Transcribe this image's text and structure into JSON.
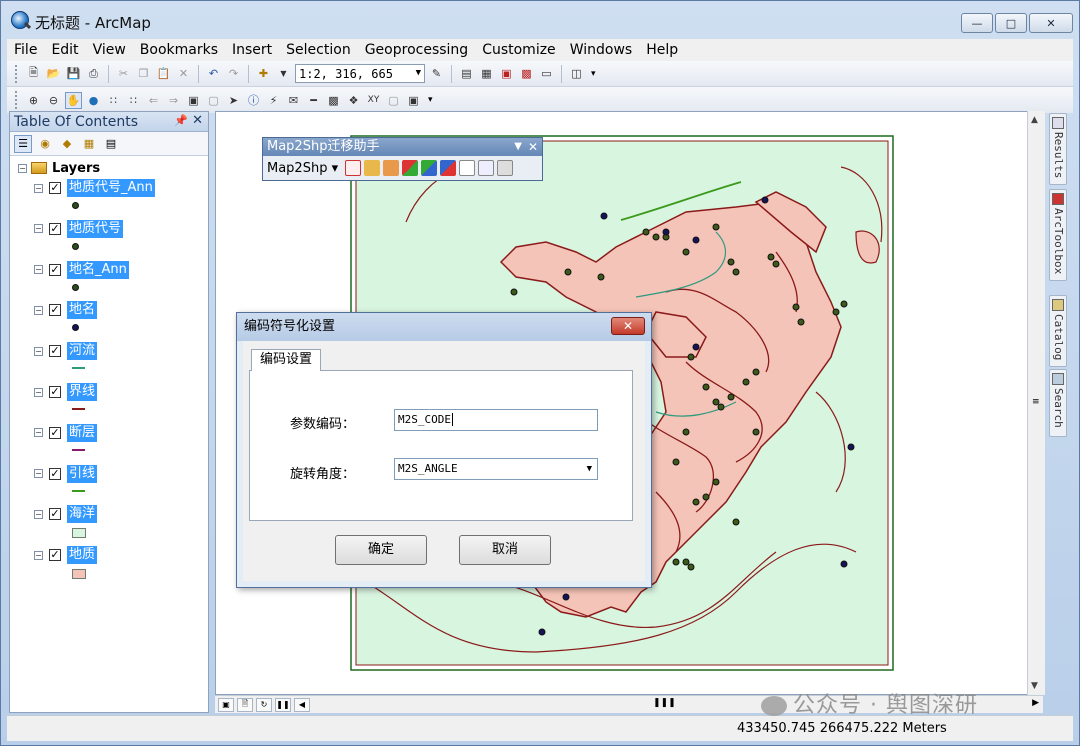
{
  "window": {
    "title": "无标题 - ArcMap",
    "buttons": [
      "minimize",
      "maximize",
      "close"
    ]
  },
  "menubar": {
    "items": [
      "File",
      "Edit",
      "View",
      "Bookmarks",
      "Insert",
      "Selection",
      "Geoprocessing",
      "Customize",
      "Windows",
      "Help"
    ]
  },
  "toolbar": {
    "scale": "1:2, 316, 665"
  },
  "toc": {
    "title": "Table Of Contents",
    "root_label": "Layers",
    "layers": [
      {
        "name": "地质代号_Ann",
        "symbol": "dot",
        "color": "#2a4d1d"
      },
      {
        "name": "地质代号",
        "symbol": "dot",
        "color": "#2a4d1d"
      },
      {
        "name": "地名_Ann",
        "symbol": "dot",
        "color": "#2a4d1d"
      },
      {
        "name": "地名",
        "symbol": "dot",
        "color": "#14145a"
      },
      {
        "name": "河流",
        "symbol": "line",
        "color": "#2e9a7e"
      },
      {
        "name": "界线",
        "symbol": "line",
        "color": "#8b1a1a"
      },
      {
        "name": "断层",
        "symbol": "line",
        "color": "#8b1a6b"
      },
      {
        "name": "引线",
        "symbol": "line",
        "color": "#3a9a1a"
      },
      {
        "name": "海洋",
        "symbol": "box",
        "color": "#d8f5e0"
      },
      {
        "name": "地质",
        "symbol": "box",
        "color": "#f5c4b8"
      }
    ]
  },
  "floating_toolbar": {
    "title": "Map2Shp迁移助手",
    "menu_label": "Map2Shp"
  },
  "dialog": {
    "title": "编码符号化设置",
    "tab_label": "编码设置",
    "code_label": "参数编码：",
    "code_value": "M2S_CODE",
    "angle_label": "旋转角度：",
    "angle_value": "M2S_ANGLE",
    "ok_label": "确定",
    "cancel_label": "取消"
  },
  "side_tabs": [
    "Results",
    "ArcToolbox",
    "Catalog",
    "Search"
  ],
  "statusbar": {
    "coords": "433450.745  266475.222 Meters"
  },
  "watermark": "公众号 · 舆图深研",
  "colors": {
    "ocean": "#d8f5e0",
    "geology": "#f5c4b8",
    "boundary": "#8b1a1a",
    "river": "#2e9a7e",
    "selection": "#3399ff"
  }
}
